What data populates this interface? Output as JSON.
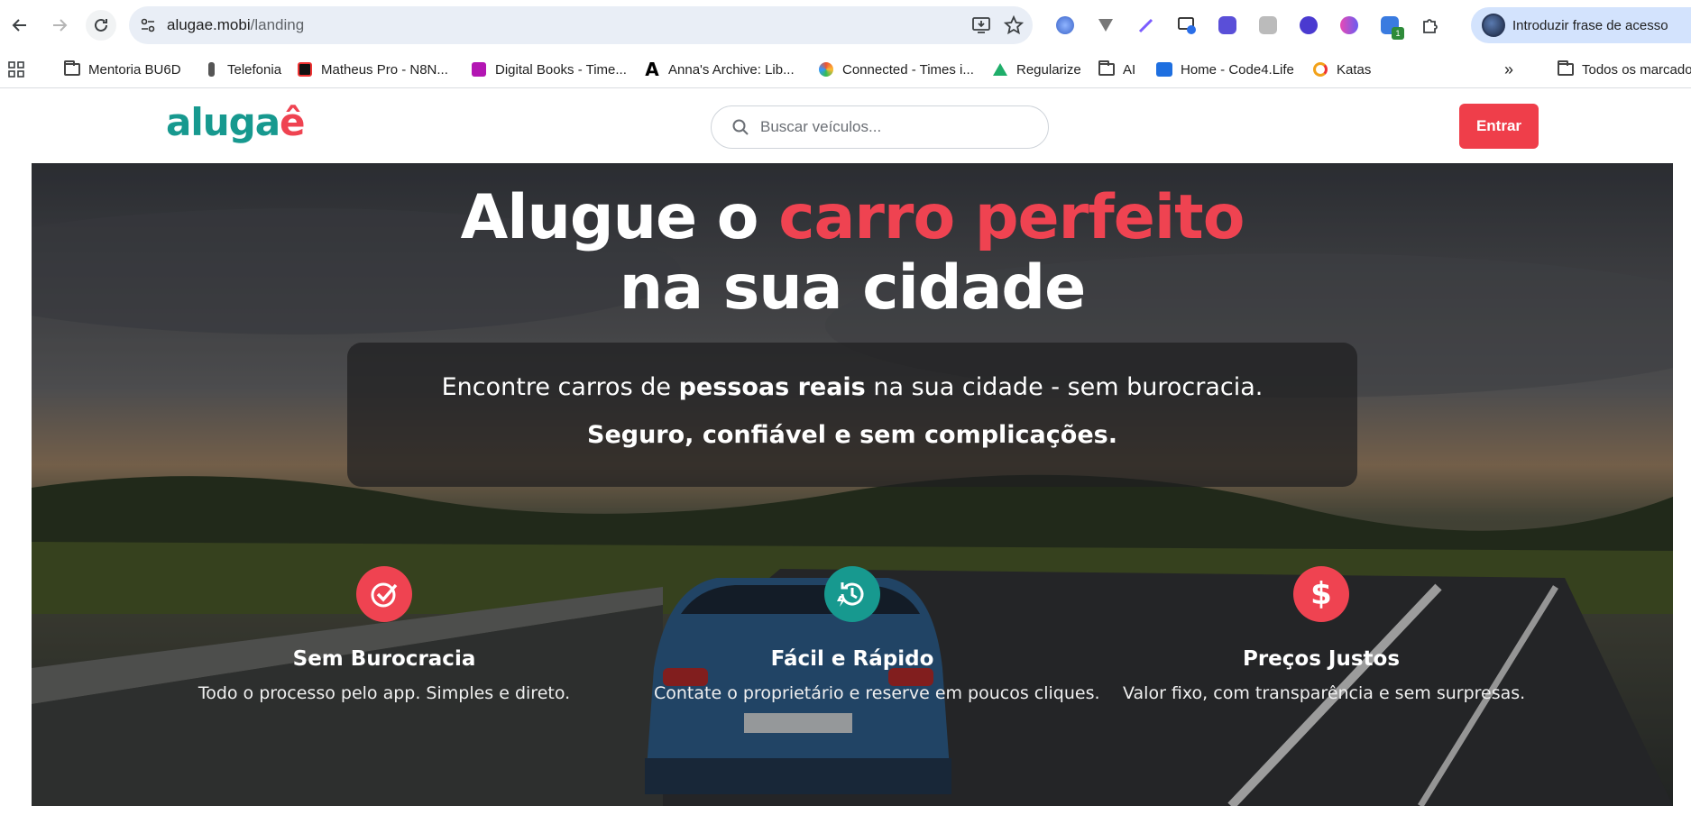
{
  "browser": {
    "url_host": "alugae.mobi",
    "url_path": "/landing",
    "profile_label": "Introduzir frase de acesso",
    "extension_badge": "1",
    "bookmarks": [
      {
        "label": "Mentoria BU6D",
        "icon": "folder-icon"
      },
      {
        "label": "Telefonia",
        "icon": "phone-icon"
      },
      {
        "label": "Matheus Pro - N8N...",
        "icon": "n8n-icon"
      },
      {
        "label": "Digital Books - Time...",
        "icon": "book-icon"
      },
      {
        "label": "Anna's Archive: Lib...",
        "icon": "annas-archive-icon"
      },
      {
        "label": "Connected - Times i...",
        "icon": "connected-icon"
      },
      {
        "label": "Regularize",
        "icon": "regularize-icon"
      },
      {
        "label": "AI",
        "icon": "folder-icon"
      },
      {
        "label": "Home - Code4.Life",
        "icon": "code4life-icon"
      },
      {
        "label": "Katas",
        "icon": "katas-icon"
      }
    ],
    "all_bookmarks_label": "Todos os marcadores"
  },
  "header": {
    "logo_main": "aluga",
    "logo_accent": "ê",
    "search_placeholder": "Buscar veículos...",
    "login_label": "Entrar"
  },
  "hero": {
    "title_prefix": "Alugue o ",
    "title_highlight": "carro perfeito",
    "title_line2": "na sua cidade",
    "sub_pre": "Encontre carros de ",
    "sub_bold": "pessoas reais",
    "sub_post": " na sua cidade - sem burocracia.",
    "sub_line2": "Seguro, confiável e sem complicações."
  },
  "features": [
    {
      "title": "Sem Burocracia",
      "desc": "Todo o processo pelo app. Simples e direto.",
      "icon": "check-circle-icon",
      "color": "#ef4351"
    },
    {
      "title": "Fácil e Rápido",
      "desc": "Contate o proprietário e reserve em poucos cliques.",
      "icon": "history-bolt-icon",
      "color": "#17998f"
    },
    {
      "title": "Preços Justos",
      "desc": "Valor fixo, com transparência e sem surpresas.",
      "icon": "dollar-icon",
      "color": "#ef4351"
    }
  ],
  "colors": {
    "brand_teal": "#17998f",
    "brand_red": "#ef4351",
    "login_button": "#ef3e4a"
  }
}
